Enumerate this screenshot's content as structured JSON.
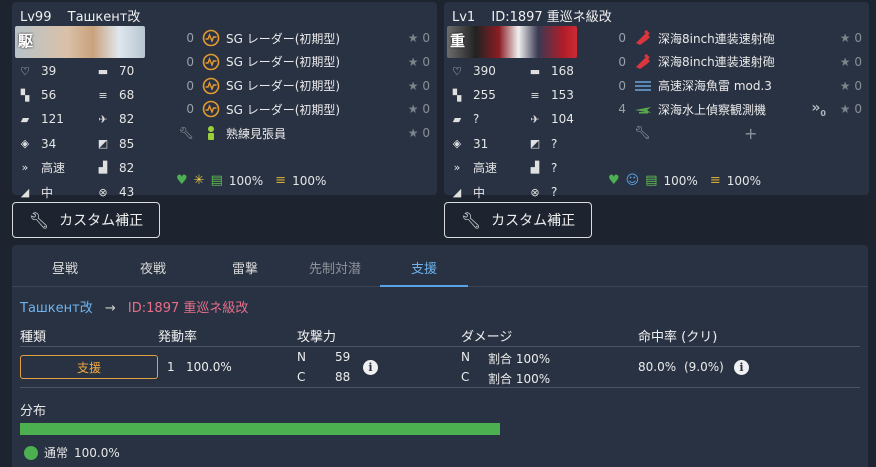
{
  "left_ship": {
    "level": "Lv99",
    "name": "Ташкент改",
    "banner_kanji": "駆",
    "stats": [
      {
        "icon": "hp-heart-icon",
        "glyph": "♡",
        "value": "39"
      },
      {
        "icon": "armor-icon",
        "glyph": "▬",
        "value": "70"
      },
      {
        "icon": "evasion-icon",
        "glyph": "▚",
        "value": "56"
      },
      {
        "icon": "torpedo-icon",
        "glyph": "≡",
        "value": "68"
      },
      {
        "icon": "firepower-icon",
        "glyph": "▰",
        "value": "121"
      },
      {
        "icon": "aa-icon",
        "glyph": "✈",
        "value": "82"
      },
      {
        "icon": "asw-icon",
        "glyph": "◈",
        "value": "34"
      },
      {
        "icon": "los-icon",
        "glyph": "◩",
        "value": "85"
      },
      {
        "icon": "speed-icon",
        "glyph": "»",
        "value": "高速"
      },
      {
        "icon": "luck-icon",
        "glyph": "▟",
        "value": "82"
      },
      {
        "icon": "range-icon",
        "glyph": "◢",
        "value": "中"
      },
      {
        "icon": "accuracy-icon",
        "glyph": "⊗",
        "value": "43"
      }
    ],
    "equips": [
      {
        "slot": "0",
        "name": "SG レーダー(初期型)",
        "stars": "0",
        "icon": "radar-icon"
      },
      {
        "slot": "0",
        "name": "SG レーダー(初期型)",
        "stars": "0",
        "icon": "radar-icon"
      },
      {
        "slot": "0",
        "name": "SG レーダー(初期型)",
        "stars": "0",
        "icon": "radar-icon"
      },
      {
        "slot": "0",
        "name": "SG レーダー(初期型)",
        "stars": "0",
        "icon": "radar-icon"
      },
      {
        "slot": "",
        "name": "熟練見張員",
        "stars": "0",
        "icon": "lookout-icon"
      }
    ],
    "fuel": "100%",
    "ammo": "100%"
  },
  "right_ship": {
    "level": "Lv1",
    "name": "ID:1897 重巡ネ級改",
    "banner_kanji": "重",
    "stats": [
      {
        "icon": "hp-heart-icon",
        "glyph": "♡",
        "value": "390"
      },
      {
        "icon": "armor-icon",
        "glyph": "▬",
        "value": "168"
      },
      {
        "icon": "evasion-icon",
        "glyph": "▚",
        "value": "255"
      },
      {
        "icon": "torpedo-icon",
        "glyph": "≡",
        "value": "153"
      },
      {
        "icon": "firepower-icon",
        "glyph": "▰",
        "value": "?"
      },
      {
        "icon": "aa-icon",
        "glyph": "✈",
        "value": "104"
      },
      {
        "icon": "asw-icon",
        "glyph": "◈",
        "value": "31"
      },
      {
        "icon": "los-icon",
        "glyph": "◩",
        "value": "?"
      },
      {
        "icon": "speed-icon",
        "glyph": "»",
        "value": "高速"
      },
      {
        "icon": "luck-icon",
        "glyph": "▟",
        "value": "?"
      },
      {
        "icon": "range-icon",
        "glyph": "◢",
        "value": "中"
      },
      {
        "icon": "accuracy-icon",
        "glyph": "⊗",
        "value": "?"
      }
    ],
    "equips": [
      {
        "slot": "0",
        "name": "深海8inch連装速射砲",
        "stars": "0",
        "icon": "gun-icon"
      },
      {
        "slot": "0",
        "name": "深海8inch連装速射砲",
        "stars": "0",
        "icon": "gun-icon"
      },
      {
        "slot": "0",
        "name": "高速深海魚雷 mod.3",
        "stars": "0",
        "icon": "torpedo-equip-icon"
      },
      {
        "slot": "4",
        "name": "深海水上偵察観測機",
        "stars": "0",
        "icon": "seaplane-icon",
        "proficiency": "0"
      },
      {
        "slot": "",
        "name": "",
        "stars": "",
        "icon": "add-icon"
      }
    ],
    "fuel": "100%",
    "ammo": "100%"
  },
  "buttons": {
    "custom_label": "カスタム補正"
  },
  "tabs": [
    {
      "label": "昼戦",
      "state": "normal"
    },
    {
      "label": "夜戦",
      "state": "normal"
    },
    {
      "label": "雷撃",
      "state": "normal"
    },
    {
      "label": "先制対潜",
      "state": "dim"
    },
    {
      "label": "支援",
      "state": "active"
    }
  ],
  "route": {
    "from": "Ташкент改",
    "arrow": "→",
    "to": "ID:1897 重巡ネ級改"
  },
  "table": {
    "headers": [
      "種類",
      "発動率",
      "攻撃力",
      "ダメージ",
      "命中率 (クリ)"
    ],
    "row": {
      "type": "支援",
      "rate_count": "1",
      "rate_pct": "100.0%",
      "atk_n_label": "N",
      "atk_n": "59",
      "atk_c_label": "C",
      "atk_c": "88",
      "dmg_n_label": "N",
      "dmg_n": "割合 100%",
      "dmg_c_label": "C",
      "dmg_c": "割合 100%",
      "hit": "80.0%",
      "crit": "(9.0%)"
    }
  },
  "distribution": {
    "label": "分布",
    "items": [
      {
        "name": "通常",
        "pct": "100.0%",
        "fraction": 1.0
      }
    ]
  },
  "colors": {
    "accent_blue": "#6fb3ee",
    "enemy_pink": "#e66f8a",
    "support_orange": "#f0a840",
    "bar_green": "#4caf50"
  }
}
